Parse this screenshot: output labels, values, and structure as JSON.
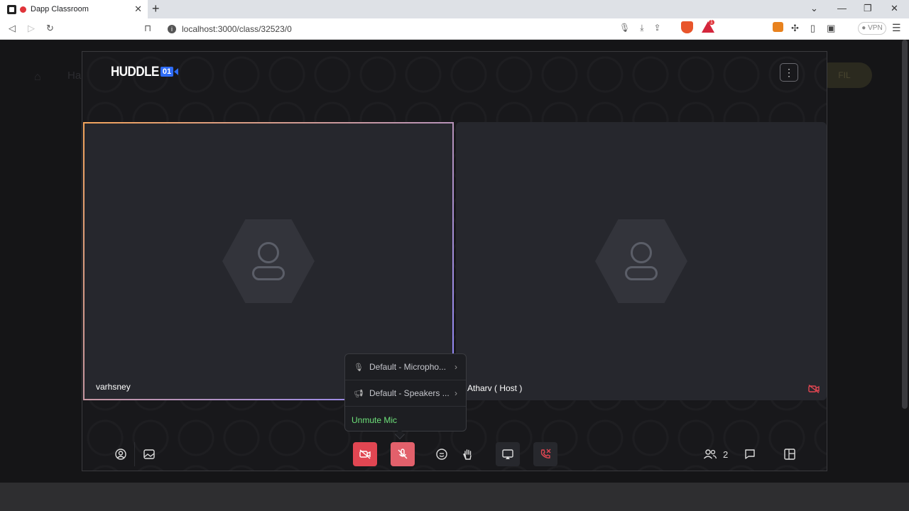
{
  "browser": {
    "tab_title": "Dapp Classroom",
    "url": "localhost:3000/class/32523/0",
    "vpn_label": "VPN",
    "bat_badge": "1"
  },
  "background_page": {
    "nav_text": "Ha",
    "pill_text": "FIL"
  },
  "huddle": {
    "logo_word": "HUDDLE",
    "logo_num": "01",
    "tiles": [
      {
        "name": "varhsney",
        "active": true
      },
      {
        "name": "Atharv ( Host )",
        "camera_off": true
      }
    ],
    "mic_menu": {
      "microphone": "Default - Micropho...",
      "speakers": "Default - Speakers ...",
      "unmute": "Unmute Mic"
    },
    "peer_count": "2"
  },
  "colors": {
    "accent_red": "#e14652",
    "unmute_green": "#6ee27a",
    "brand_blue": "#2f6cf6"
  }
}
